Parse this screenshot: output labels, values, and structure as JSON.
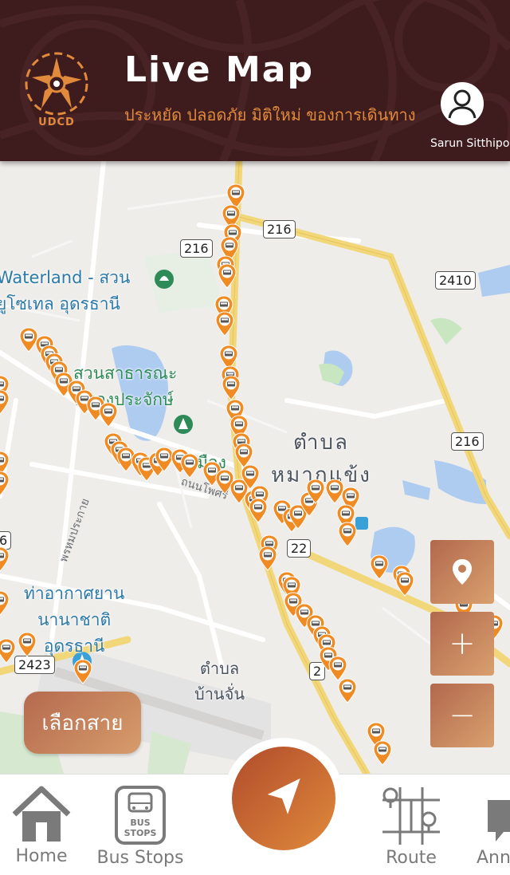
{
  "header": {
    "logo_text": "UDCD",
    "title": "Live Map",
    "subtitle": "ประหยัด ปลอดภัย มิติใหม่ ของการเดินทาง",
    "user_name": "Sarun Sitthipong"
  },
  "map": {
    "labels": {
      "waterland_line1": "Waterland - สวน",
      "waterland_line2": "ยูโซเทล อุดรธานี",
      "park_line1": "สวนสาธารณะ",
      "park_line2": "หนองประจักษ์",
      "tambon_makkhaeng_line1": "ตำบล",
      "tambon_makkhaeng_line2": "หมากแข้ง",
      "airport_line1": "ท่าอากาศยาน",
      "airport_line2": "นานาชาติ",
      "airport_line3": "อุดรธานี",
      "tambon_banchan_line1": "ตำบล",
      "tambon_banchan_line2": "บ้านจั่น",
      "mueang": "เมือง",
      "street_phosri": "ถนนโพศรี",
      "street_prachak": "พรหมประกาย"
    },
    "shields": {
      "r216_top": "216",
      "r216_left": "216",
      "r2410": "2410",
      "r216_right": "216",
      "r22": "22",
      "r2423": "2423",
      "r6": "6",
      "r2_bottom": "2"
    }
  },
  "controls": {
    "location_icon": "location-pin-icon",
    "zoom_in_label": "+",
    "zoom_out_label": "−",
    "line_select_label": "เลือกสาย"
  },
  "nav": {
    "home_label": "Home",
    "bus_stops_label": "Bus Stops",
    "bus_stops_icon_text_1": "BUS",
    "bus_stops_icon_text_2": "STOPS",
    "route_label": "Route",
    "announce_label": "Annou"
  },
  "colors": {
    "header_bg": "#3e1c1e",
    "accent_orange": "#e28a3b",
    "pin_orange": "#f08a22",
    "button_gradient_start": "#b2694d",
    "button_gradient_end": "#d9a06e"
  }
}
